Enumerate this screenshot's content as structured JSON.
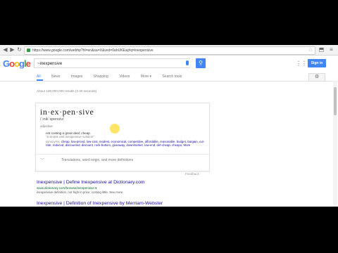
{
  "browser": {
    "url": "https://www.google.com/webhp?hl=en&sa=X&ved=0ahUKEwj#q=inexpensive",
    "url_protocol": "https://"
  },
  "google": {
    "logo_letters": [
      "G",
      "o",
      "o",
      "g",
      "l",
      "e"
    ],
    "logo_colors": [
      "#4285f4",
      "#ea4335",
      "#fbbc05",
      "#4285f4",
      "#34a853",
      "#ea4335"
    ],
    "query": "~inexpensive",
    "signin_label": "Sign in",
    "tabs": [
      "All",
      "News",
      "Images",
      "Shopping",
      "Videos",
      "More ▾",
      "Search tools"
    ],
    "stats": "About 139,000,000 results (0.30 seconds)"
  },
  "dictionary": {
    "word": "in·ex·pen·sive",
    "pronunciation": "/ˌinikˈspensiv/",
    "part_of_speech": "adjective",
    "definition": "not costing a great deal; cheap.",
    "example": "\"a simple and inexpensive solution\"",
    "synonyms_label": "synonyms:",
    "synonyms": "cheap, low-priced, low-cost, modest, economical, competitive, affordable, reasonable, budget, bargain, cut-rate, reduced, discounted, discount, rock-bottom, giveaway, downmarket, low-end, dirt-cheap, cheapo; More",
    "more_label": "Translations, word origin, and more definitions",
    "feedback": "Feedback"
  },
  "results": [
    {
      "title": "Inexpensive | Define Inexpensive at Dictionary.com",
      "url": "www.dictionary.com/browse/inexpensive ▾",
      "snippet": "inexpensive definition, not high in price; costing little. See more."
    },
    {
      "title": "Inexpensive | Definition of Inexpensive by Merriam-Webster"
    }
  ]
}
